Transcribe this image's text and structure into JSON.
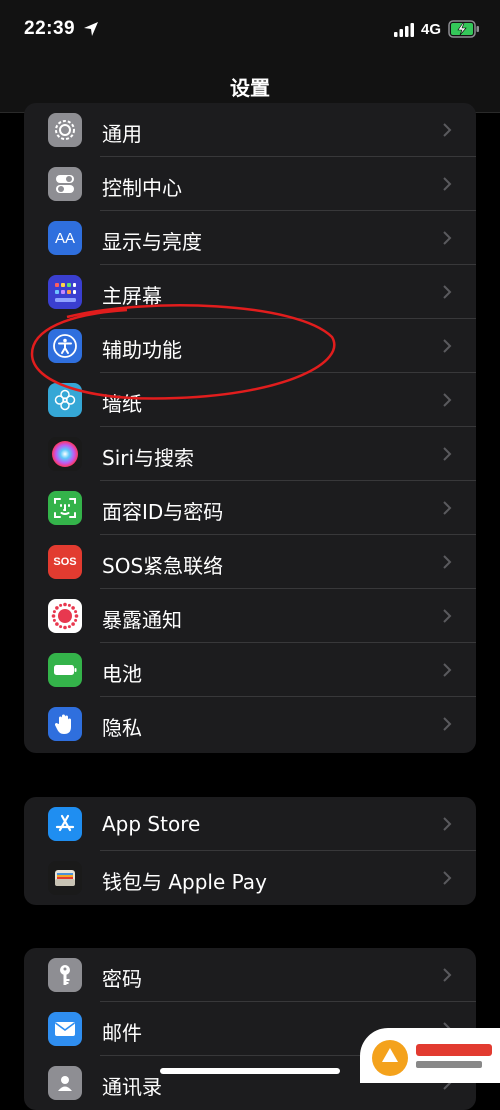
{
  "status": {
    "time": "22:39",
    "network": "4G"
  },
  "nav": {
    "title": "设置"
  },
  "groups": [
    {
      "items": [
        {
          "label": "通用",
          "icon": "gear-icon",
          "color": "#8e8e93"
        },
        {
          "label": "控制中心",
          "icon": "toggles-icon",
          "color": "#8e8e93"
        },
        {
          "label": "显示与亮度",
          "icon": "text-size-icon",
          "color": "#2f6fde",
          "icon_text": "AA"
        },
        {
          "label": "主屏幕",
          "icon": "home-screen-grid-icon",
          "color": "#3a3fd0"
        },
        {
          "label": "辅助功能",
          "icon": "accessibility-icon",
          "color": "#2f6fde"
        },
        {
          "label": "墙纸",
          "icon": "flower-icon",
          "color": "#35a7d6"
        },
        {
          "label": "Siri与搜索",
          "icon": "siri-icon",
          "color": "#1a1a1a"
        },
        {
          "label": "面容ID与密码",
          "icon": "face-id-icon",
          "color": "#34b34a"
        },
        {
          "label": "SOS紧急联络",
          "icon": "sos-icon",
          "color": "#e23b30",
          "icon_text": "SOS"
        },
        {
          "label": "暴露通知",
          "icon": "exposure-icon",
          "color": "#ffffff"
        },
        {
          "label": "电池",
          "icon": "battery-icon",
          "color": "#34b34a"
        },
        {
          "label": "隐私",
          "icon": "hand-icon",
          "color": "#2f6fde"
        }
      ]
    },
    {
      "items": [
        {
          "label": "App Store",
          "icon": "app-store-icon",
          "color": "#1f8ef1"
        },
        {
          "label": "钱包与 Apple Pay",
          "icon": "wallet-icon",
          "color": "#1a1a1a"
        }
      ]
    },
    {
      "items": [
        {
          "label": "密码",
          "icon": "key-icon",
          "color": "#8e8e93"
        },
        {
          "label": "邮件",
          "icon": "mail-icon",
          "color": "#2f8ef0"
        },
        {
          "label": "通讯录",
          "icon": "contacts-icon",
          "color": "#8e8e93"
        }
      ]
    }
  ],
  "annotation": {
    "target": "辅助功能",
    "color": "#e11d1d"
  }
}
